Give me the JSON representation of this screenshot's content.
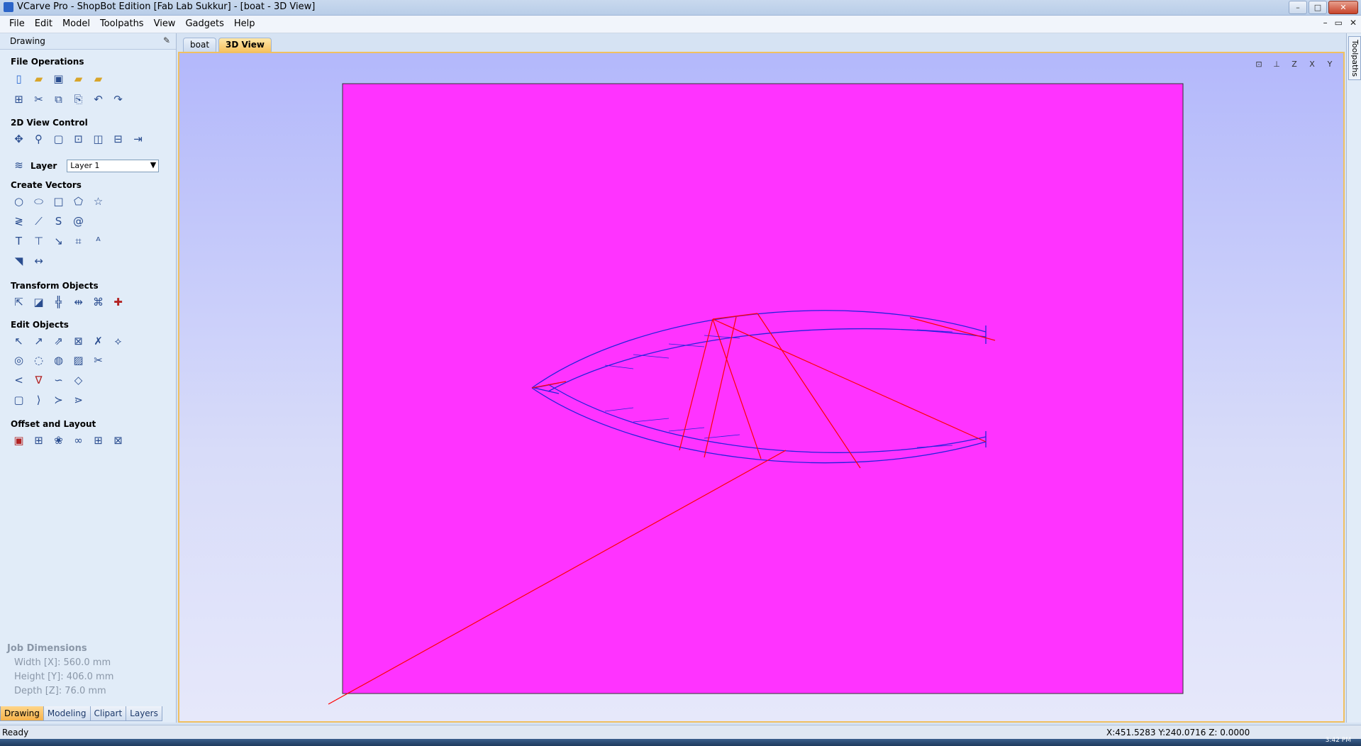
{
  "titlebar": {
    "title": "VCarve Pro - ShopBot Edition [Fab Lab Sukkur] - [boat - 3D View]",
    "buttons": [
      "–",
      "□",
      "✕"
    ]
  },
  "menu": {
    "items": [
      "File",
      "Edit",
      "Model",
      "Toolpaths",
      "View",
      "Gadgets",
      "Help"
    ],
    "mdi_buttons": [
      "–",
      "▭",
      "✕"
    ]
  },
  "left_panel": {
    "title": "Drawing",
    "pin_icon": "pin-icon",
    "sections": {
      "file_operations": "File Operations",
      "view_control": "2D View Control",
      "create_vectors": "Create Vectors",
      "transform_objects": "Transform Objects",
      "edit_objects": "Edit Objects",
      "offset_layout": "Offset and Layout"
    },
    "layer_label": "Layer",
    "layer_value": "Layer 1",
    "job_dimensions": {
      "title": "Job Dimensions",
      "width": "Width  [X]: 560.0 mm",
      "height": "Height [Y]: 406.0 mm",
      "depth": "Depth  [Z]: 76.0 mm"
    },
    "bottom_tabs": [
      "Drawing",
      "Modeling",
      "Clipart",
      "Layers"
    ],
    "active_tab": "Drawing"
  },
  "document_tabs": [
    "boat",
    "3D View"
  ],
  "active_document_tab": "3D View",
  "view_tools": [
    "fit-view-icon",
    "iso-view-icon",
    "top-z-view-icon",
    "front-x-view-icon",
    "side-y-view-icon"
  ],
  "view_tool_labels": [
    "⊡",
    "⊥",
    "Z",
    "X",
    "Y"
  ],
  "right_strip": {
    "tab": "Toolpaths"
  },
  "colors": {
    "material": "#ff33ff",
    "vectors": "#2222dd",
    "toolpath": "#ff0000",
    "accent_tab": "#f6b24a"
  },
  "status": {
    "left": "Ready",
    "coords": "X:451.5283 Y:240.0716 Z:  0.0000"
  },
  "taskbar": {
    "clock": "3:42 PM"
  }
}
